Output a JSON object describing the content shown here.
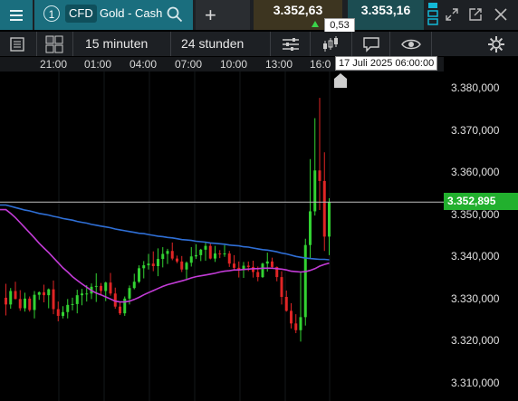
{
  "header": {
    "menu_icon": "hamburger-icon",
    "instrument_number": "1",
    "instrument_type": "CFD",
    "instrument_name": "Gold - Cash",
    "add_label": "+",
    "bid": "3.352,63",
    "ask": "3.353,16",
    "spread": "0,53",
    "colors": {
      "teal": "#1a6e7e",
      "up": "#3ad34a",
      "bid_bg": "#3d3520",
      "ask_bg": "#1c4d52"
    }
  },
  "toolbar": {
    "interval": "15 minuten",
    "range": "24 stunden",
    "icons": [
      "list-icon",
      "layout-icon",
      "indicators-icon",
      "candles-icon",
      "comment-icon",
      "eye-icon",
      "settings-icon"
    ]
  },
  "timeline": {
    "labels": [
      "21:00",
      "01:00",
      "04:00",
      "07:00",
      "10:00",
      "13:00",
      "16:0"
    ],
    "crosshair_time": "17 Juli 2025 06:00:00"
  },
  "chart_data": {
    "type": "candlestick",
    "yaxis_ticks": [
      "3.380,000",
      "3.370,000",
      "3.360,000",
      "3.350,000",
      "3.340,000",
      "3.330,000",
      "3.320,000",
      "3.310,000"
    ],
    "ylim": [
      3305,
      3387
    ],
    "last_price_label": "3.352,895",
    "last_price": 3352.895,
    "colors": {
      "up": "#32d232",
      "down": "#e02525",
      "ma_blue": "#2f6fd6",
      "ma_purple": "#c23bd6",
      "price_line": "#bfbfbf"
    },
    "candles": [
      [
        3330.2,
        3333.5,
        3326.0,
        3328.6
      ],
      [
        3328.6,
        3332.5,
        3327.6,
        3331.8
      ],
      [
        3331.8,
        3334.0,
        3329.8,
        3329.9
      ],
      [
        3329.9,
        3332.0,
        3327.1,
        3327.7
      ],
      [
        3327.7,
        3331.4,
        3326.9,
        3330.0
      ],
      [
        3330.0,
        3330.5,
        3326.9,
        3327.3
      ],
      [
        3327.3,
        3331.8,
        3325.3,
        3330.9
      ],
      [
        3330.9,
        3331.7,
        3329.7,
        3331.5
      ],
      [
        3331.5,
        3333.3,
        3329.1,
        3330.8
      ],
      [
        3330.8,
        3332.4,
        3327.7,
        3332.2
      ],
      [
        3332.2,
        3334.3,
        3326.3,
        3327.5
      ],
      [
        3327.5,
        3329.3,
        3324.6,
        3325.9
      ],
      [
        3325.9,
        3328.2,
        3325.3,
        3326.8
      ],
      [
        3326.8,
        3329.9,
        3325.3,
        3328.5
      ],
      [
        3328.5,
        3330.2,
        3327.2,
        3328.7
      ],
      [
        3328.7,
        3332.1,
        3326.5,
        3330.8
      ],
      [
        3330.8,
        3332.3,
        3328.4,
        3331.2
      ],
      [
        3331.2,
        3333.2,
        3329.3,
        3331.2
      ],
      [
        3331.2,
        3333.6,
        3329.9,
        3332.8
      ],
      [
        3332.8,
        3336.0,
        3329.2,
        3333.0
      ],
      [
        3333.0,
        3333.7,
        3330.8,
        3331.8
      ],
      [
        3331.8,
        3334.0,
        3329.4,
        3333.8
      ],
      [
        3333.8,
        3336.1,
        3330.7,
        3331.2
      ],
      [
        3331.2,
        3332.6,
        3327.6,
        3328.1
      ],
      [
        3328.1,
        3329.2,
        3326.1,
        3326.5
      ],
      [
        3326.5,
        3330.5,
        3325.9,
        3330.0
      ],
      [
        3330.0,
        3333.1,
        3328.6,
        3332.5
      ],
      [
        3332.5,
        3335.9,
        3332.2,
        3334.0
      ],
      [
        3334.0,
        3337.9,
        3333.7,
        3337.2
      ],
      [
        3337.2,
        3338.9,
        3334.8,
        3337.9
      ],
      [
        3337.9,
        3340.6,
        3336.9,
        3338.3
      ],
      [
        3338.3,
        3341.2,
        3336.5,
        3337.7
      ],
      [
        3337.7,
        3341.9,
        3335.3,
        3339.4
      ],
      [
        3339.4,
        3342.2,
        3337.4,
        3340.6
      ],
      [
        3340.6,
        3341.8,
        3338.2,
        3341.3
      ],
      [
        3341.3,
        3343.3,
        3339.1,
        3339.5
      ],
      [
        3339.5,
        3340.2,
        3338.4,
        3338.8
      ],
      [
        3338.8,
        3340.1,
        3336.3,
        3336.9
      ],
      [
        3336.9,
        3338.8,
        3334.4,
        3338.5
      ],
      [
        3338.5,
        3342.2,
        3337.6,
        3340.0
      ],
      [
        3340.0,
        3342.9,
        3339.4,
        3340.3
      ],
      [
        3340.3,
        3341.8,
        3338.9,
        3341.6
      ],
      [
        3341.6,
        3343.5,
        3339.0,
        3342.5
      ],
      [
        3342.5,
        3343.2,
        3339.3,
        3339.5
      ],
      [
        3339.5,
        3342.5,
        3338.7,
        3340.7
      ],
      [
        3340.7,
        3341.5,
        3339.6,
        3340.6
      ],
      [
        3340.6,
        3342.7,
        3339.9,
        3340.7
      ],
      [
        3340.7,
        3341.3,
        3337.5,
        3338.3
      ],
      [
        3338.3,
        3340.3,
        3336.6,
        3337.3
      ],
      [
        3337.3,
        3338.8,
        3335.0,
        3336.9
      ],
      [
        3336.9,
        3338.7,
        3334.9,
        3337.8
      ],
      [
        3337.8,
        3338.8,
        3336.5,
        3337.5
      ],
      [
        3337.5,
        3339.0,
        3335.0,
        3336.3
      ],
      [
        3336.3,
        3337.6,
        3334.1,
        3335.1
      ],
      [
        3335.1,
        3338.5,
        3334.9,
        3338.3
      ],
      [
        3338.3,
        3340.9,
        3336.4,
        3338.8
      ],
      [
        3338.8,
        3339.7,
        3337.2,
        3337.5
      ],
      [
        3337.5,
        3337.6,
        3334.1,
        3335.1
      ],
      [
        3335.1,
        3336.5,
        3328.6,
        3330.4
      ],
      [
        3330.4,
        3331.9,
        3326.9,
        3327.1
      ],
      [
        3327.1,
        3328.9,
        3322.9,
        3324.1
      ],
      [
        3324.1,
        3326.3,
        3321.8,
        3322.5
      ],
      [
        3322.5,
        3336.2,
        3319.8,
        3325.6
      ],
      [
        3325.6,
        3344.2,
        3323.6,
        3342.7
      ],
      [
        3342.7,
        3363.1,
        3339.6,
        3350.7
      ],
      [
        3350.7,
        3372.8,
        3349.7,
        3360.4
      ],
      [
        3360.4,
        3377.6,
        3351.0,
        3357.9
      ],
      [
        3357.9,
        3364.7,
        3341.3,
        3344.7
      ],
      [
        3344.7,
        3353.8,
        3340.3,
        3352.9
      ]
    ],
    "ma_blue": [
      3352.2,
      3351.9,
      3351.6,
      3351.3,
      3351.0,
      3350.8,
      3350.5,
      3350.2,
      3350.0,
      3349.8,
      3349.5,
      3349.3,
      3349.0,
      3348.8,
      3348.6,
      3348.3,
      3348.1,
      3347.9,
      3347.6,
      3347.4,
      3347.2,
      3347.0,
      3346.8,
      3346.5,
      3346.3,
      3346.1,
      3345.9,
      3345.7,
      3345.5,
      3345.4,
      3345.2,
      3345.0,
      3344.8,
      3344.7,
      3344.5,
      3344.4,
      3344.2,
      3344.0,
      3343.9,
      3343.8,
      3343.6,
      3343.5,
      3343.4,
      3343.2,
      3343.1,
      3343.0,
      3342.9,
      3342.7,
      3342.6,
      3342.5,
      3342.3,
      3342.2,
      3342.0,
      3341.8,
      3341.6,
      3341.5,
      3341.3,
      3341.1,
      3340.8,
      3340.6,
      3340.3,
      3340.0,
      3339.8,
      3339.6,
      3339.5,
      3339.4,
      3339.3,
      3339.3,
      3339.2
    ],
    "ma_purple": [
      3351.1,
      3350.2,
      3349.2,
      3348.0,
      3346.8,
      3345.6,
      3344.4,
      3343.1,
      3342.0,
      3340.9,
      3339.7,
      3338.5,
      3337.3,
      3336.3,
      3335.2,
      3334.3,
      3333.5,
      3332.7,
      3331.9,
      3331.3,
      3330.9,
      3330.4,
      3329.9,
      3329.4,
      3329.2,
      3329.2,
      3329.4,
      3329.8,
      3330.3,
      3330.9,
      3331.4,
      3331.9,
      3332.4,
      3332.9,
      3333.3,
      3333.6,
      3333.9,
      3334.2,
      3334.5,
      3334.9,
      3335.2,
      3335.4,
      3335.6,
      3335.8,
      3336.0,
      3336.3,
      3336.5,
      3336.6,
      3336.8,
      3336.8,
      3336.9,
      3337.0,
      3337.1,
      3337.1,
      3337.2,
      3337.2,
      3337.2,
      3337.1,
      3337.0,
      3336.8,
      3336.5,
      3336.4,
      3336.3,
      3336.4,
      3336.7,
      3337.1,
      3337.7,
      3338.1,
      3338.4
    ]
  }
}
